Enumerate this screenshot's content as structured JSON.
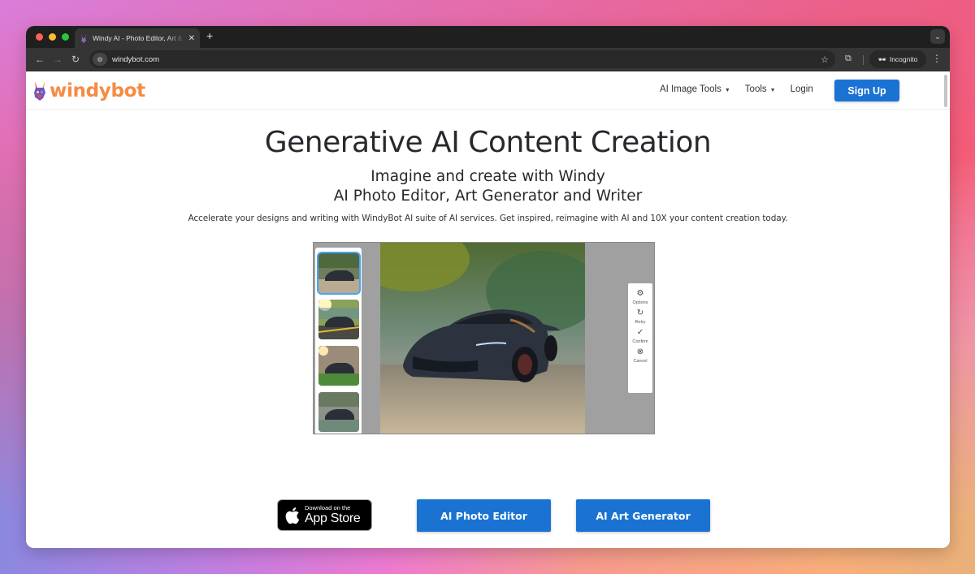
{
  "browser": {
    "tab_title": "Windy AI - Photo Editor, Art & Writer",
    "tab_close": "✕",
    "new_tab": "+",
    "url": "windybot.com",
    "incognito_label": "Incognito",
    "icons": {
      "back": "←",
      "forward": "→",
      "reload": "↻",
      "site_info": "⚙",
      "star": "☆",
      "extensions": "⧉",
      "menu": "⋮",
      "tab_dropdown": "⌄",
      "incognito": "🕶"
    }
  },
  "navbar": {
    "logo_text": "windybot",
    "links": [
      {
        "label": "AI Image Tools",
        "has_dropdown": true
      },
      {
        "label": "Tools",
        "has_dropdown": true
      },
      {
        "label": "Login",
        "has_dropdown": false
      }
    ],
    "caret": "▼",
    "signup_label": "Sign Up"
  },
  "hero": {
    "title": "Generative AI Content Creation",
    "subtitle_line1": "Imagine and create with Windy",
    "subtitle_line2": "AI Photo Editor, Art Generator and Writer",
    "description": "Accelerate your designs and writing with WindyBot AI suite of AI services. Get inspired, reimagine with AI and 10X your content creation today."
  },
  "demo": {
    "thumbnails_count": 4,
    "selected_thumbnail": 1,
    "tools": [
      {
        "icon": "⚙",
        "label": "Options"
      },
      {
        "icon": "↻",
        "label": "Retry"
      },
      {
        "icon": "✓",
        "label": "Confirm"
      },
      {
        "icon": "⊗",
        "label": "Cancel"
      }
    ]
  },
  "cta": {
    "appstore_small": "Download on the",
    "appstore_big": "App Store",
    "photo_editor_label": "AI Photo Editor",
    "art_generator_label": "AI Art Generator"
  },
  "colors": {
    "brand_orange": "#f68b43",
    "primary_blue": "#1a73d3"
  }
}
